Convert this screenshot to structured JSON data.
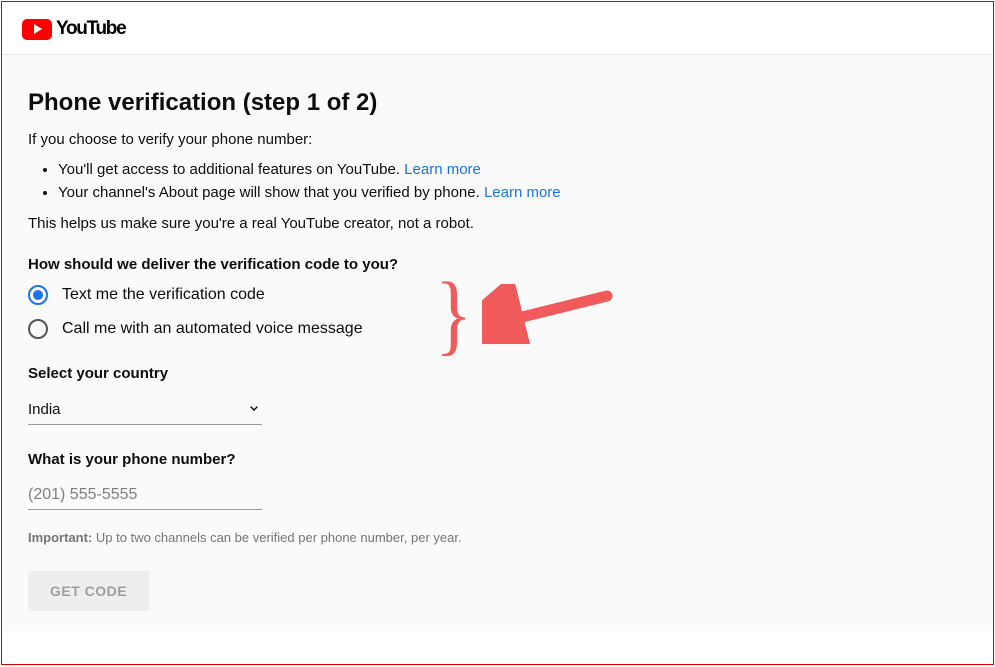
{
  "logo": {
    "text": "YouTube"
  },
  "heading": "Phone verification (step 1 of 2)",
  "intro": "If you choose to verify your phone number:",
  "benefits": {
    "item1_text": "You'll get access to additional features on YouTube. ",
    "item1_link": "Learn more",
    "item2_text": "Your channel's About page will show that you verified by phone. ",
    "item2_link": "Learn more"
  },
  "helper": "This helps us make sure you're a real YouTube creator, not a robot.",
  "delivery": {
    "question": "How should we deliver the verification code to you?",
    "option1": "Text me the verification code",
    "option2": "Call me with an automated voice message",
    "selected": "text"
  },
  "country": {
    "label": "Select your country",
    "value": "India"
  },
  "phone": {
    "label": "What is your phone number?",
    "placeholder": "(201) 555-5555",
    "value": ""
  },
  "note": {
    "bold": "Important:",
    "text": " Up to two channels can be verified per phone number, per year."
  },
  "button": {
    "label": "GET CODE"
  }
}
